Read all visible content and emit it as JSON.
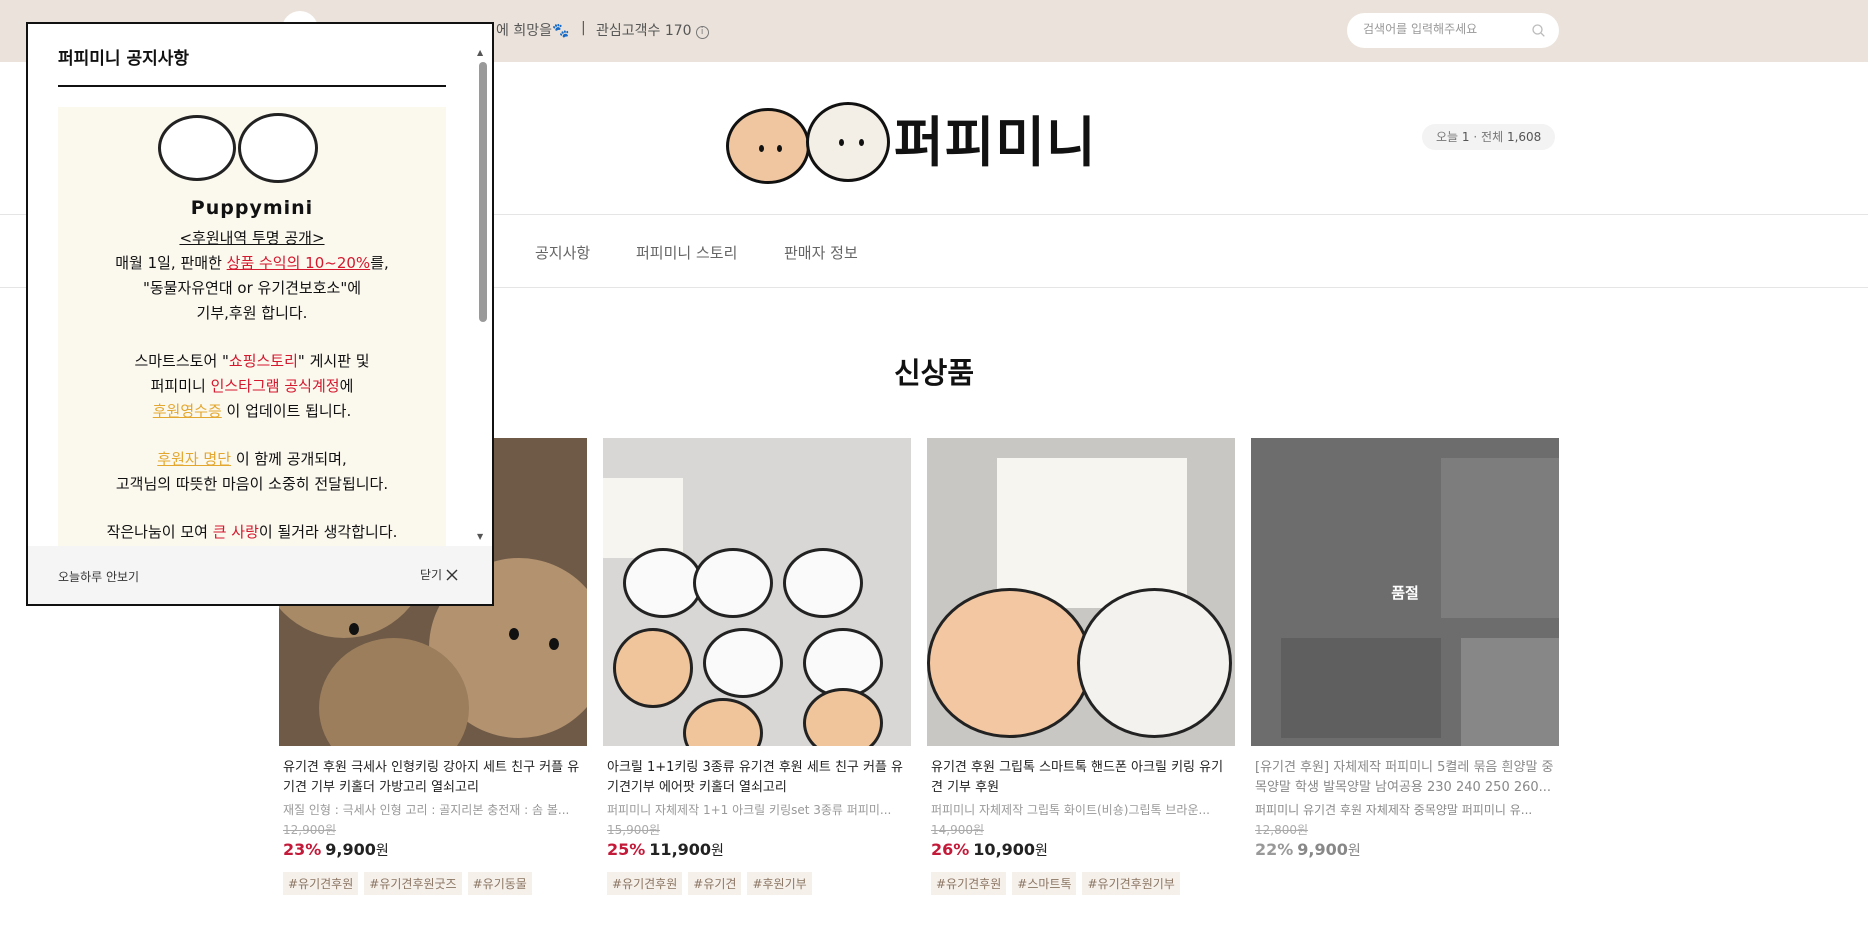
{
  "topbar": {
    "tagline": "에 희망을🐾",
    "separator": "|",
    "interest_label": "관심고객수 170",
    "info_icon": "ⓘ",
    "search_placeholder": "검색어를 입력해주세요"
  },
  "header": {
    "brand": "퍼피미니",
    "visitors": {
      "today_label": "오늘",
      "today_count": "1",
      "total_label": "전체",
      "total_count": "1,608"
    }
  },
  "nav": {
    "items": [
      {
        "label": "공지사항"
      },
      {
        "label": "퍼피미니 스토리"
      },
      {
        "label": "판매자 정보"
      }
    ]
  },
  "section": {
    "title": "신상품"
  },
  "products": [
    {
      "name": "유기견 후원 극세사 인형키링 강아지 세트 친구 커플 유기견 기부 키홀더 가방고리 열쇠고리",
      "desc": "재질 인형 : 극세사 인형 고리 : 골지리본 충전재 : 솜 볼...",
      "orig": "12,900원",
      "rate": "23%",
      "price": "9,900",
      "won": "원",
      "tags": [
        "#유기견후원",
        "#유기견후원굿즈",
        "#유기동물"
      ]
    },
    {
      "name": "아크릴 1+1키링 3종류 유기견 후원 세트 친구 커플 유기견기부 에어팟 키홀더 열쇠고리",
      "desc": "퍼피미니 자체제작 1+1 아크릴 키링set 3종류 퍼피미...",
      "orig": "15,900원",
      "rate": "25%",
      "price": "11,900",
      "won": "원",
      "tags": [
        "#유기견후원",
        "#유기견",
        "#후원기부"
      ]
    },
    {
      "name": "유기견 후원 그립톡 스마트톡 핸드폰 아크릴 키링 유기견 기부 후원",
      "desc": "퍼피미니 자체제작 그립톡 화이트(비숑)그립톡 브라운...",
      "orig": "14,900원",
      "rate": "26%",
      "price": "10,900",
      "won": "원",
      "tags": [
        "#유기견후원",
        "#스마트톡",
        "#유기견후원기부"
      ]
    },
    {
      "name": "[유기견 후원] 자체제작 퍼피미니 5켤레 묶음 흰양말 중목양말 학생 발목양말 남여공용 230 240 250 260...",
      "desc": "퍼피미니 유기견 후원 자체제작 중목양말 퍼피미니 유...",
      "orig": "12,800원",
      "rate": "22%",
      "price": "9,900",
      "won": "원",
      "soldout": "품절",
      "tags": []
    }
  ],
  "popup": {
    "title": "퍼피미니 공지사항",
    "notice": {
      "brand": "Puppymini",
      "l1": "<후원내역 투명 공개>",
      "l2a": "매월 1일, 판매한 ",
      "l2b": "상품 수익의 10~20%",
      "l2c": "를,",
      "l3": "\"동물자유연대 or 유기견보호소\"에",
      "l4": "기부,후원 합니다.",
      "l5a": "스마트스토어 \"",
      "l5b": "쇼핑스토리",
      "l5c": "\" 게시판 및",
      "l6a": "퍼피미니 ",
      "l6b": "인스타그램 공식계정",
      "l6c": "에",
      "l7a": "후원영수증",
      "l7b": " 이 업데이트 됩니다.",
      "l8a": "후원자 명단",
      "l8b": " 이 함께 공개되며,",
      "l9": "고객님의 따뜻한 마음이 소중히 전달됩니다.",
      "l10a": "작은나눔이 모여 ",
      "l10b": "큰 사랑",
      "l10c": "이 될거라 생각합니다."
    },
    "today_hide": "오늘하루 안보기",
    "close": "닫기"
  }
}
